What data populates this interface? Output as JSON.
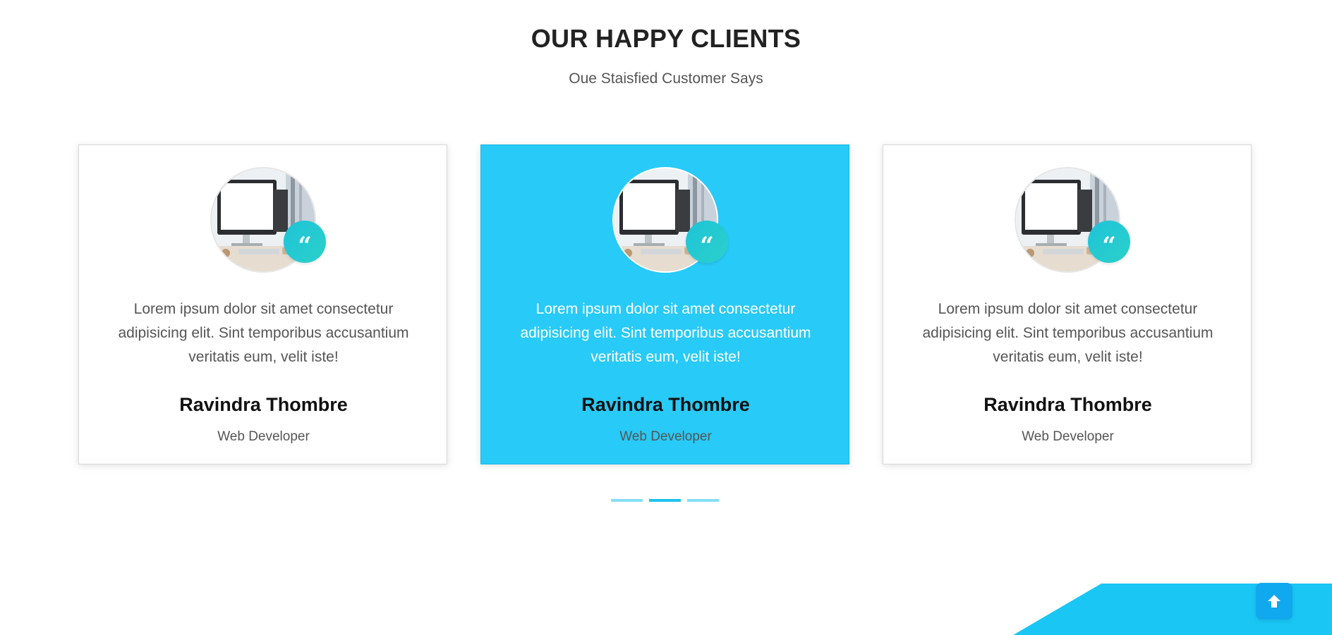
{
  "section": {
    "title": "OUR HAPPY CLIENTS",
    "subtitle": "Oue Staisfied Customer Says"
  },
  "testimonials": [
    {
      "text": "Lorem ipsum dolor sit amet consectetur adipisicing elit. Sint temporibus accusantium veritatis eum, velit iste!",
      "name": "Ravindra Thombre",
      "role": "Web Developer",
      "active": false
    },
    {
      "text": "Lorem ipsum dolor sit amet consectetur adipisicing elit. Sint temporibus accusantium veritatis eum, velit iste!",
      "name": "Ravindra Thombre",
      "role": "Web Developer",
      "active": true
    },
    {
      "text": "Lorem ipsum dolor sit amet consectetur adipisicing elit. Sint temporibus accusantium veritatis eum, velit iste!",
      "name": "Ravindra Thombre",
      "role": "Web Developer",
      "active": false
    }
  ],
  "icons": {
    "quote": "quote-icon",
    "scroll_top": "arrow-up-icon"
  },
  "carousel": {
    "dot_count": 3,
    "active_dot": 2
  },
  "colors": {
    "accent": "#28caf7",
    "quote_badge": "#1ec3d9",
    "dot_active": "#1ec3ee",
    "dot_inactive": "#86dff5",
    "footer": "#19c6f4",
    "scroll_button": "#10a8ef"
  }
}
